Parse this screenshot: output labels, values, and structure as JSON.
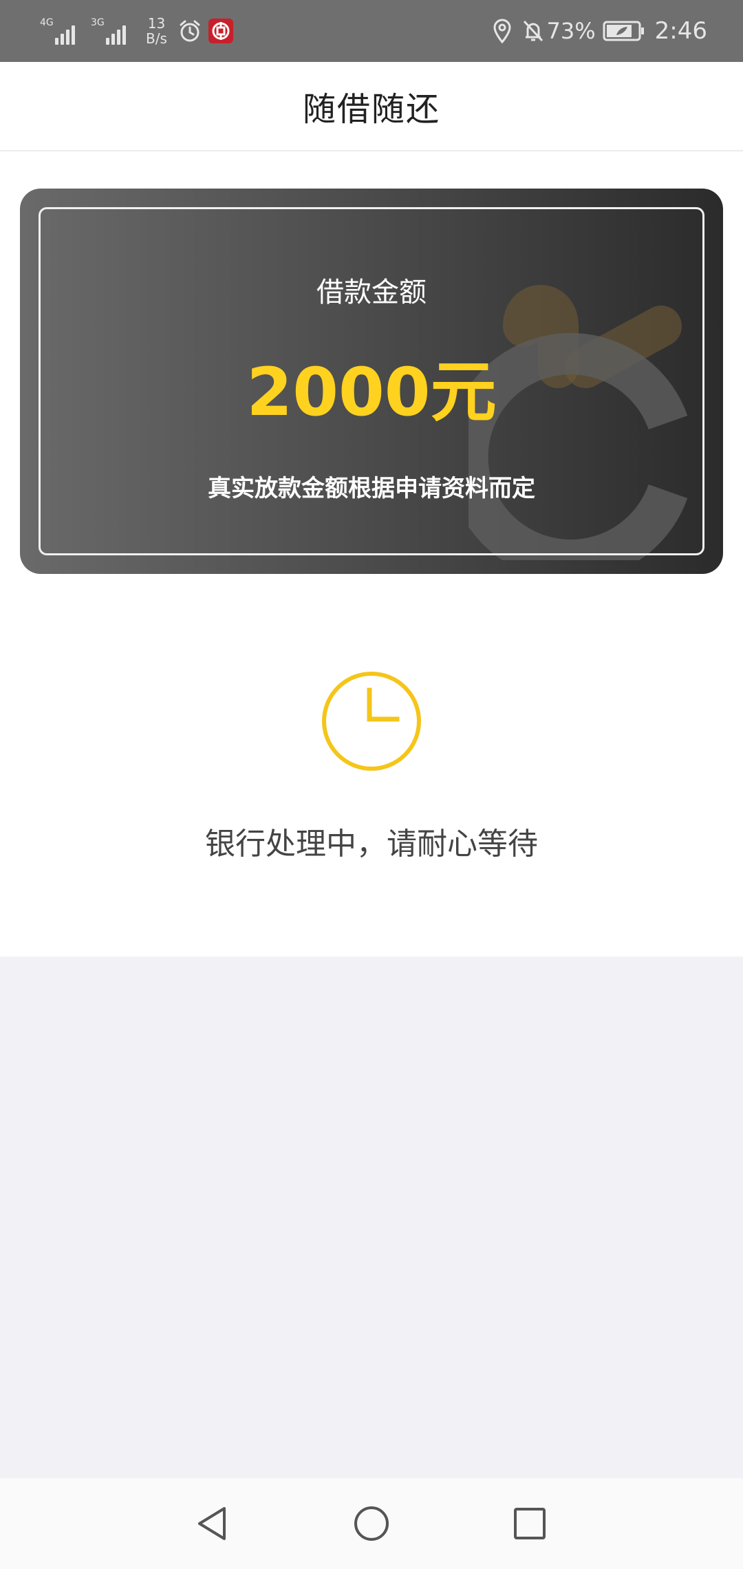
{
  "status_bar": {
    "signal1_tech": "4G",
    "signal2_tech": "3G",
    "net_speed_value": "13",
    "net_speed_unit": "B/s",
    "battery_pct": "73%",
    "time": "2:46"
  },
  "header": {
    "title": "随借随还"
  },
  "card": {
    "label": "借款金额",
    "amount": "2000元",
    "note": "真实放款金额根据申请资料而定"
  },
  "status": {
    "message": "银行处理中，请耐心等待"
  },
  "colors": {
    "accent_yellow": "#ffd21f",
    "status_bar_bg": "#6f6f6f",
    "page_bg": "#f2f2f6"
  },
  "icons": {
    "alarm": "alarm-clock-icon",
    "app": "bank-app-icon",
    "location": "location-pin-icon",
    "mute": "bell-muted-icon",
    "battery": "battery-icon",
    "status": "clock-icon",
    "back": "back-triangle-icon",
    "home": "home-circle-icon",
    "recent": "recent-square-icon"
  }
}
